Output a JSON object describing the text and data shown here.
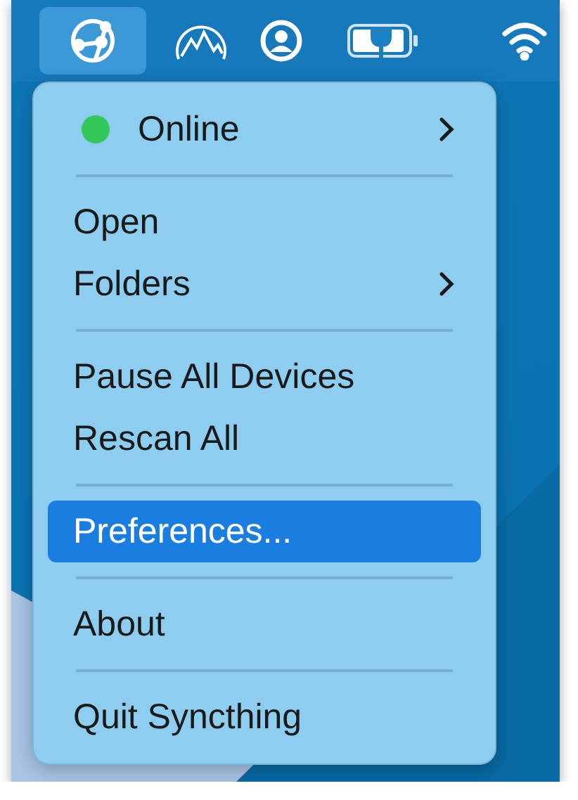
{
  "menu_bar": {
    "icons": [
      {
        "kind": "network",
        "selected": true
      },
      {
        "kind": "mountain",
        "selected": false
      },
      {
        "kind": "person",
        "selected": false
      },
      {
        "kind": "battery",
        "selected": false
      },
      {
        "kind": "wifi",
        "selected": false
      }
    ]
  },
  "menu": {
    "sections": [
      [
        {
          "label": "Online",
          "color": "#34c759",
          "submenu": true,
          "selected": false
        }
      ],
      [
        {
          "label": "Open",
          "submenu": false,
          "selected": false
        },
        {
          "label": "Folders",
          "submenu": true,
          "selected": false
        }
      ],
      [
        {
          "label": "Pause All Devices",
          "submenu": false,
          "selected": false
        },
        {
          "label": "Rescan All",
          "submenu": false,
          "selected": false
        }
      ],
      [
        {
          "label": "Preferences...",
          "submenu": false,
          "selected": true
        }
      ],
      [
        {
          "label": "About",
          "submenu": false,
          "selected": false
        }
      ],
      [
        {
          "label": "Quit Syncthing",
          "submenu": false,
          "selected": false
        }
      ]
    ]
  }
}
